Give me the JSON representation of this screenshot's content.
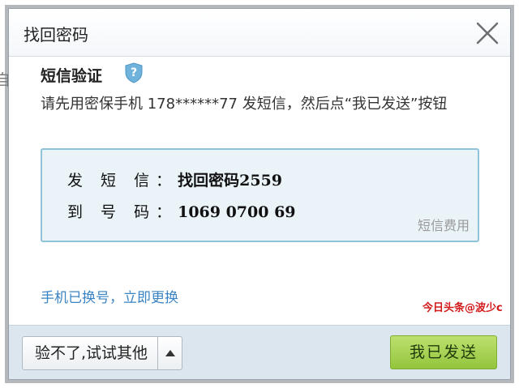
{
  "background": {
    "fragment_text": "自"
  },
  "dialog": {
    "title": "找回密码",
    "close_icon": "close-icon"
  },
  "sms_verify": {
    "title": "短信验证",
    "help_icon": "shield-question-icon",
    "instruction": "请先用密保手机 178******77 发短信，然后点“我已发送”按钮",
    "send_label": "发 短 信：",
    "send_value": "找回密码2559",
    "number_label": "到 号 码：",
    "number_value": "1069 0700 69",
    "fee_link": "短信费用"
  },
  "change_phone_link": "手机已换号，立即更换",
  "watermark": "今日头条@波少c",
  "footer": {
    "try_other_label": "验不了,试试其他",
    "try_other_arrow_icon": "triangle-up-icon",
    "sent_button_label": "我已发送"
  },
  "colors": {
    "link": "#3a84c4",
    "sms_box_bg": "#e9f3f8",
    "sms_box_border": "#8fc3dc",
    "primary_button": "#a3d04b",
    "footer_bg": "#dbe6ef",
    "watermark": "#d21a1a"
  }
}
